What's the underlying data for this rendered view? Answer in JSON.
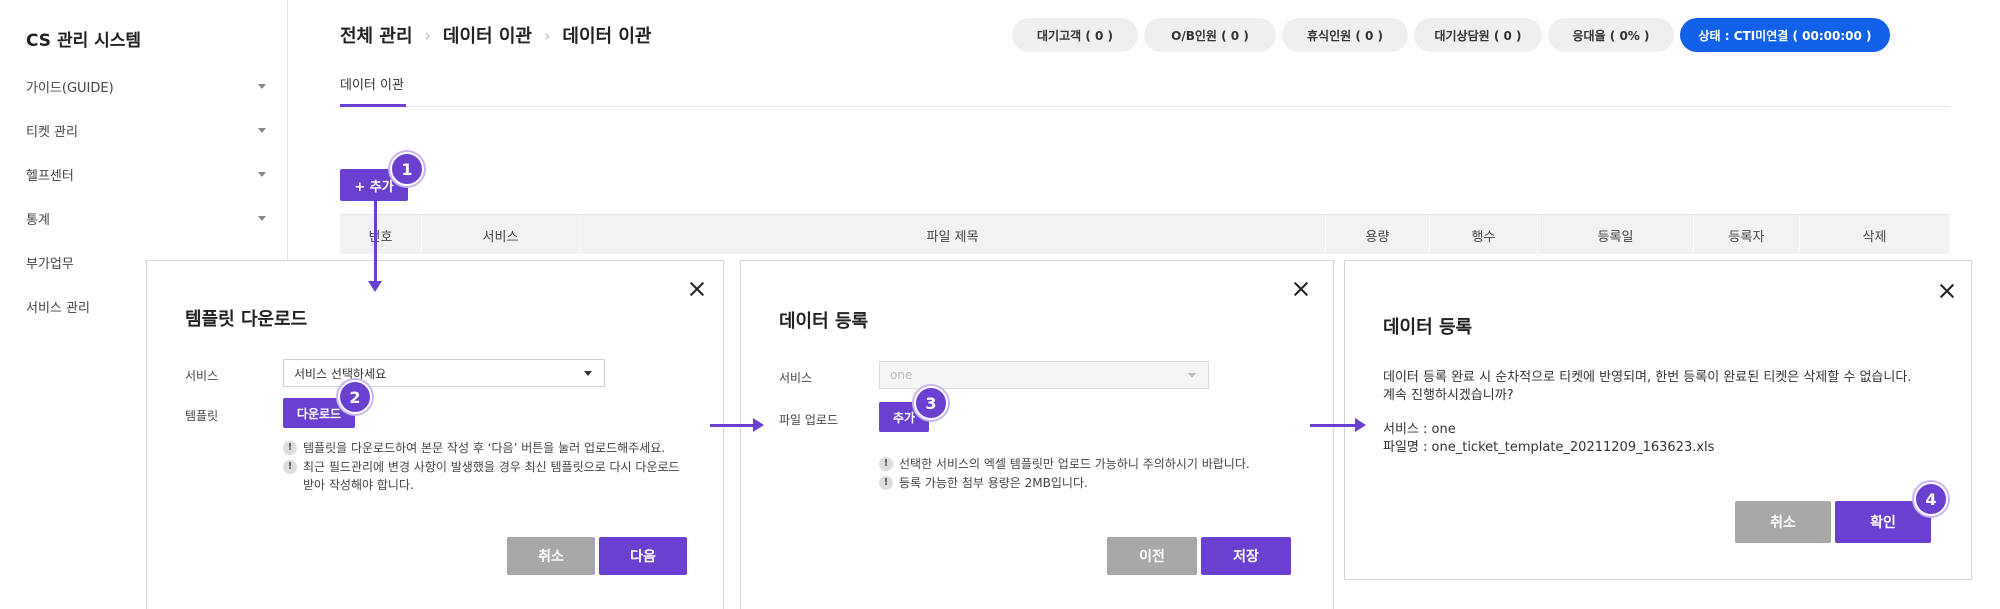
{
  "sidebar": {
    "app_title": "CS 관리 시스템",
    "items": [
      {
        "label": "가이드(GUIDE)"
      },
      {
        "label": "티켓 관리"
      },
      {
        "label": "헬프센터"
      },
      {
        "label": "통계"
      },
      {
        "label": "부가업무"
      },
      {
        "label": "서비스 관리"
      }
    ]
  },
  "header": {
    "breadcrumb": [
      "전체 관리",
      "데이터 이관",
      "데이터 이관"
    ],
    "status": [
      {
        "label": "대기고객 ( 0 )"
      },
      {
        "label": "O/B인원 ( 0 )"
      },
      {
        "label": "휴식인원 ( 0 )"
      },
      {
        "label": "대기상담원 ( 0 )"
      },
      {
        "label": "응대율 ( 0% )"
      },
      {
        "label": "상태 : CTI미연결 ( 00:00:00 )"
      }
    ],
    "active_status_color": "#1060e8"
  },
  "tab": {
    "label": "데이터 이관"
  },
  "toolbar": {
    "add_label": "+ 추가"
  },
  "table": {
    "columns": [
      "번호",
      "서비스",
      "파일 제목",
      "용량",
      "행수",
      "등록일",
      "등록자",
      "삭제"
    ]
  },
  "steps": [
    "1",
    "2",
    "3",
    "4"
  ],
  "modal_template": {
    "title": "템플릿 다운로드",
    "service_label": "서비스",
    "service_select": "서비스 선택하세요",
    "template_label": "템플릿",
    "download_label": "다운로드",
    "notes": [
      "템플릿을 다운로드하여 본문 작성 후 ‘다음’ 버튼을 눌러 업로드해주세요.",
      "최근 필드관리에 변경 사항이 발생했을 경우 최신 템플릿으로 다시 다운로드 받아 작성해야 합니다."
    ],
    "cancel_label": "취소",
    "next_label": "다음"
  },
  "modal_register": {
    "title": "데이터 등록",
    "service_label": "서비스",
    "service_value": "one",
    "upload_label": "파일 업로드",
    "add_label": "추가",
    "notes": [
      "선택한 서비스의 엑셀 템플릿만 업로드 가능하니 주의하시기 바랍니다.",
      "등록 가능한 첨부 용량은 2MB입니다."
    ],
    "prev_label": "이전",
    "save_label": "저장"
  },
  "modal_confirm": {
    "title": "데이터 등록",
    "message_line1": "데이터 등록 완료 시 순차적으로 티켓에 반영되며, 한번 등록이 완료된 티켓은 삭제할 수 없습니다.",
    "message_line2": "계속 진행하시겠습니까?",
    "service_line": "서비스 : one",
    "file_line": "파일명 : one_ticket_template_20211209_163623.xls",
    "cancel_label": "취소",
    "confirm_label": "확인"
  },
  "colors": {
    "accent": "#6b3fd0",
    "button_gray": "#a8a8a8"
  }
}
